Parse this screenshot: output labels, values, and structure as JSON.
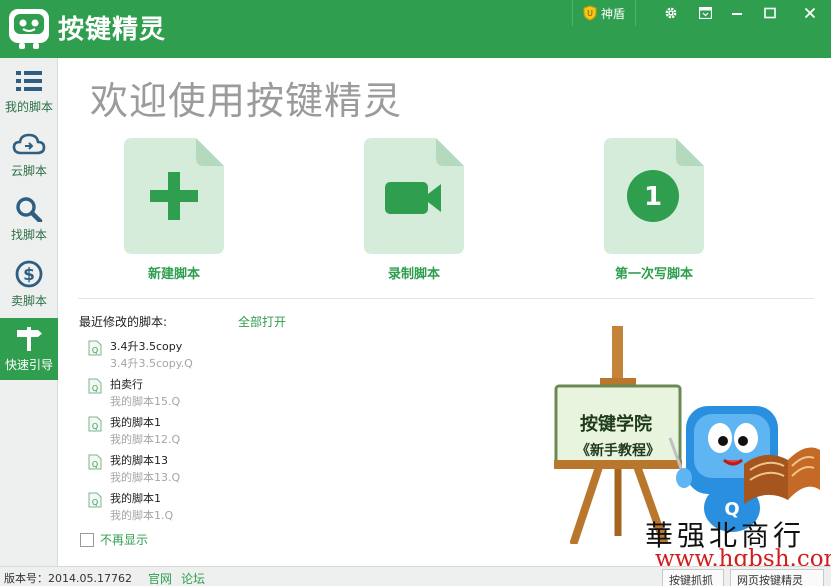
{
  "window": {
    "title": "按键精灵",
    "shield_label": "神盾",
    "settings_icon": "gear-icon",
    "skin_icon": "skin-icon",
    "minimize_icon": "minimize-icon",
    "maximize_icon": "maximize-icon",
    "close_icon": "close-icon"
  },
  "sidebar": {
    "items": [
      {
        "label": "我的脚本",
        "icon": "list-icon",
        "active": false
      },
      {
        "label": "云脚本",
        "icon": "cloud-icon",
        "active": false
      },
      {
        "label": "找脚本",
        "icon": "search-icon",
        "active": false
      },
      {
        "label": "卖脚本",
        "icon": "dollar-icon",
        "active": false
      },
      {
        "label": "快速引导",
        "icon": "signpost-icon",
        "active": true
      }
    ]
  },
  "main": {
    "welcome": "欢迎使用按键精灵",
    "actions": [
      {
        "label": "新建脚本",
        "icon": "plus-document-icon"
      },
      {
        "label": "录制脚本",
        "icon": "video-document-icon"
      },
      {
        "label": "第一次写脚本",
        "icon": "number-one-document-icon",
        "badge": "1"
      }
    ],
    "recent_heading": "最近修改的脚本:",
    "open_all": "全部打开",
    "recent": [
      {
        "name": "3.4升3.5copy",
        "path": "3.4升3.5copy.Q"
      },
      {
        "name": "拍卖行",
        "path": "我的脚本15.Q"
      },
      {
        "name": "我的脚本1",
        "path": "我的脚本12.Q"
      },
      {
        "name": "我的脚本13",
        "path": "我的脚本13.Q"
      },
      {
        "name": "我的脚本1",
        "path": "我的脚本1.Q"
      }
    ],
    "dont_show": "不再显示",
    "academy": {
      "line1": "按键学院",
      "line2": "《新手教程》"
    }
  },
  "watermark": {
    "title": "華强北商行",
    "url": "www.hqbsh.com"
  },
  "statusbar": {
    "version": "版本号：2014.05.17762",
    "link_site": "官网",
    "link_forum": "论坛",
    "btn_capture": "按键抓抓",
    "btn_web": "网页按键精灵"
  },
  "colors": {
    "brand": "#2f9e4e",
    "card": "#d4ecd9",
    "fold": "#b4d9bd"
  }
}
